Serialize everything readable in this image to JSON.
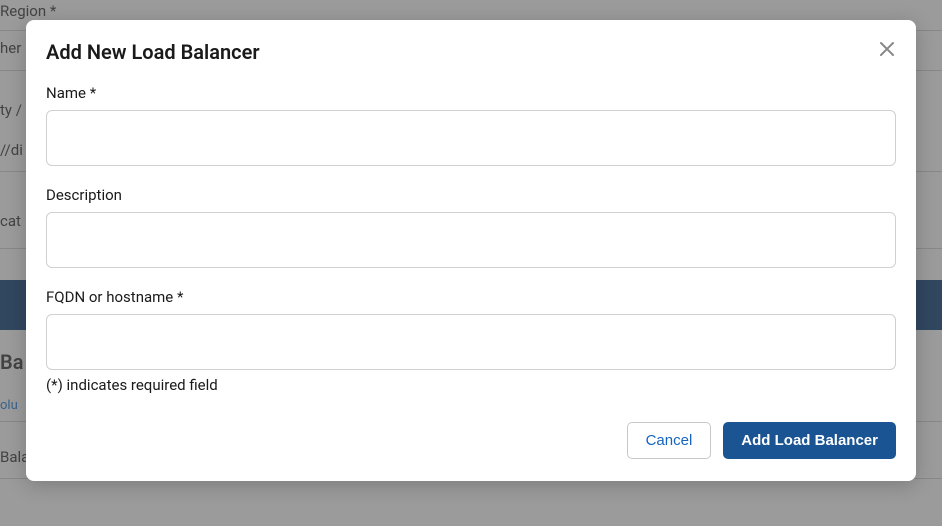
{
  "background": {
    "region_label": "Region *",
    "partial1": "her",
    "partial2": "ty /",
    "partial3": "//di",
    "partial4": "cat",
    "partial5": "Ba",
    "partial6": "olu",
    "partial7": "Bala"
  },
  "modal": {
    "title": "Add New Load Balancer",
    "fields": {
      "name_label": "Name *",
      "name_value": "",
      "description_label": "Description",
      "description_value": "",
      "fqdn_label": "FQDN or hostname *",
      "fqdn_value": ""
    },
    "required_note": "(*) indicates required field",
    "buttons": {
      "cancel": "Cancel",
      "submit": "Add Load Balancer"
    }
  }
}
